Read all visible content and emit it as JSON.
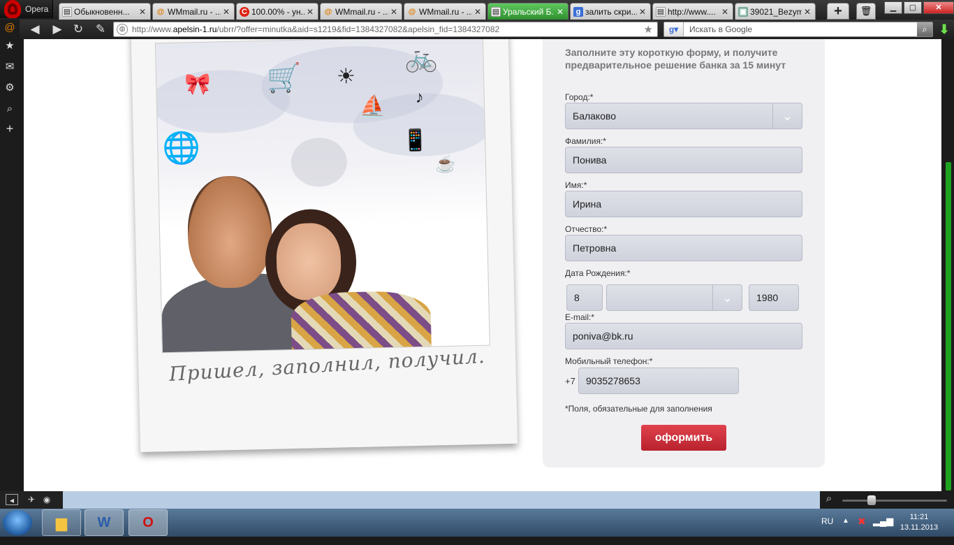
{
  "browser": {
    "menu_label": "Opera",
    "tabs": [
      {
        "title": "Обыкновенн...",
        "icon": "page-icon",
        "active": false
      },
      {
        "title": "WMmail.ru - ...",
        "icon": "wmmail-icon",
        "active": false
      },
      {
        "title": "100.00% - ун...",
        "icon": "copyright-icon",
        "active": false
      },
      {
        "title": "WMmail.ru - ...",
        "icon": "wmmail-icon",
        "active": false
      },
      {
        "title": "WMmail.ru - ...",
        "icon": "wmmail-icon",
        "active": false
      },
      {
        "title": "Уральский Б...",
        "icon": "page-icon",
        "active": true
      },
      {
        "title": "залить скри...",
        "icon": "google-icon",
        "active": false
      },
      {
        "title": "http://www....",
        "icon": "page-icon",
        "active": false
      },
      {
        "title": "39021_Bezym...",
        "icon": "image-icon",
        "active": false
      }
    ],
    "url_prefix": "http://www.",
    "url_domain": "apelsin-1.ru",
    "url_rest": "/ubrr/?offer=minutka&aid=s1219&fid=1384327082&apelsin_fid=1384327082",
    "search_placeholder": "Искать в Google",
    "colors": {
      "accent": "#2e8f2e",
      "scroll": "#1fa21f"
    }
  },
  "page": {
    "caption": "Пришел, заполнил, получил.",
    "form": {
      "title": "Заполните эту короткую форму, и получите предварительное решение банка за 15 минут",
      "city_label": "Город:*",
      "city_value": "Балаково",
      "lastname_label": "Фамилия:*",
      "lastname_value": "Понива",
      "firstname_label": "Имя:*",
      "firstname_value": "Ирина",
      "patronymic_label": "Отчество:*",
      "patronymic_value": "Петровна",
      "birthdate_label": "Дата Рождения:*",
      "birth_day": "8",
      "birth_month": "",
      "birth_year": "1980",
      "email_label": "E-mail:*",
      "email_value": "poniva@bk.ru",
      "phone_label": "Мобильный телефон:*",
      "phone_prefix": "+7",
      "phone_value": "9035278653",
      "required_note": "*Поля, обязательные для заполнения",
      "submit_label": "оформить",
      "submit_color": "#c8303b"
    }
  },
  "taskbar": {
    "lang": "RU",
    "time": "11:21",
    "date": "13.11.2013"
  }
}
